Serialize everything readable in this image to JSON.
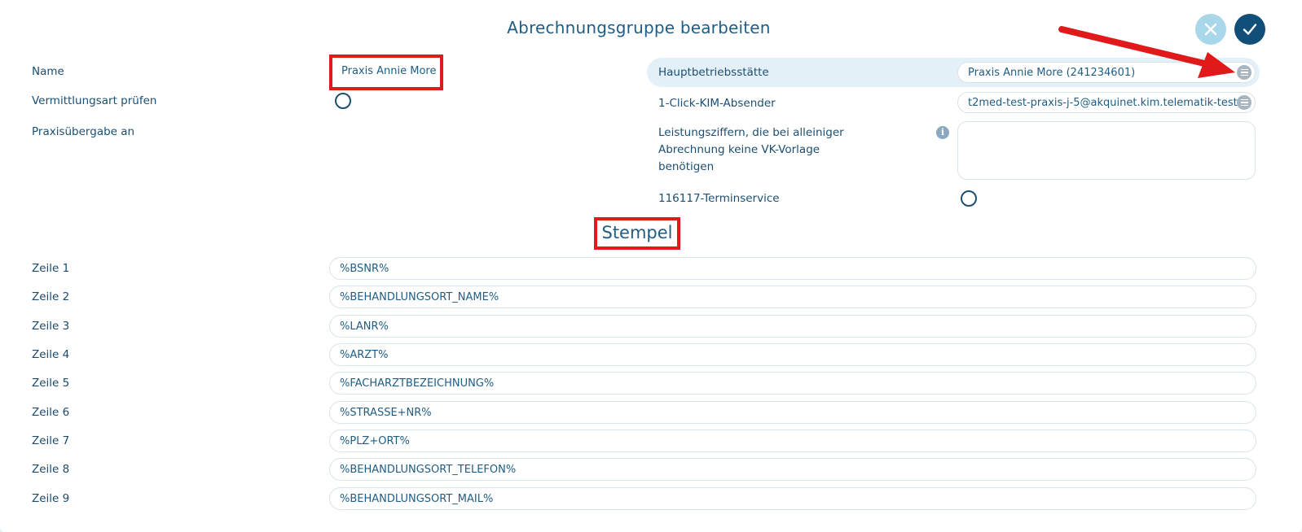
{
  "dialog": {
    "title": "Abrechnungsgruppe bearbeiten",
    "cancel_icon": "close-icon",
    "confirm_icon": "check-icon"
  },
  "left_fields": {
    "name_label": "Name",
    "name_value": "Praxis Annie More",
    "vermittlungsart_label": "Vermittlungsart prüfen",
    "praxisuebergabe_label": "Praxisübergabe an"
  },
  "right_fields": {
    "hauptbetriebsstaette_label": "Hauptbetriebsstätte",
    "hauptbetriebsstaette_value": "Praxis Annie More (241234601)",
    "kim_label": "1-Click-KIM-Absender",
    "kim_value": "t2med-test-praxis-j-5@akquinet.kim.telematik-test",
    "leistungsziffern_label_line1": "Leistungsziffern, die bei alleiniger",
    "leistungsziffern_label_line2": "Abrechnung keine VK-Vorlage",
    "leistungsziffern_label_line3": "benötigen",
    "leistungsziffern_value": "",
    "terminservice_label": "116117-Terminservice"
  },
  "stempel": {
    "heading": "Stempel",
    "rows": [
      {
        "label": "Zeile 1",
        "value": "%BSNR%"
      },
      {
        "label": "Zeile 2",
        "value": "%BEHANDLUNGSORT_NAME%"
      },
      {
        "label": "Zeile 3",
        "value": "%LANR%"
      },
      {
        "label": "Zeile 4",
        "value": "%ARZT%"
      },
      {
        "label": "Zeile 5",
        "value": "%FACHARZTBEZEICHNUNG%"
      },
      {
        "label": "Zeile 6",
        "value": "%STRASSE+NR%"
      },
      {
        "label": "Zeile 7",
        "value": "%PLZ+ORT%"
      },
      {
        "label": "Zeile 8",
        "value": "%BEHANDLUNGSORT_TELEFON%"
      },
      {
        "label": "Zeile 9",
        "value": "%BEHANDLUNGSORT_MAIL%"
      }
    ]
  },
  "colors": {
    "accent": "#1f5d84",
    "confirm_button": "#0f4f78",
    "cancel_button": "#a9d7ea",
    "highlight_row": "#e4f0f7",
    "annotation_red": "#e0191b"
  }
}
